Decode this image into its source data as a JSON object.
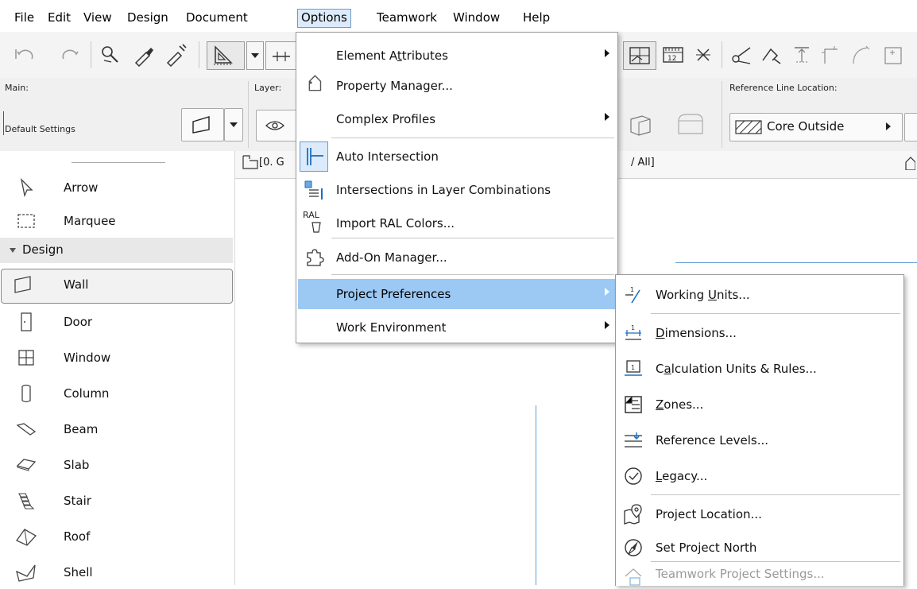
{
  "menubar": {
    "items": [
      "File",
      "Edit",
      "View",
      "Design",
      "Document",
      "Options",
      "Teamwork",
      "Window",
      "Help"
    ],
    "active": "Options"
  },
  "infobox": {
    "main_label": "Main:",
    "main_value": "Default Settings",
    "layer_label": "Layer:",
    "ref_line_label": "Reference Line Location:",
    "ref_line_value": "Core Outside"
  },
  "canvas": {
    "tab_left": "[0. G",
    "tab_right": "/ All]"
  },
  "toolbox": {
    "group": "Design",
    "tools": [
      "Arrow",
      "Marquee",
      "Wall",
      "Door",
      "Window",
      "Column",
      "Beam",
      "Slab",
      "Stair",
      "Roof",
      "Shell"
    ],
    "selected": "Wall"
  },
  "options_menu": {
    "items": [
      {
        "label": "Element Attributes",
        "submenu": true
      },
      {
        "label": "Property Manager...",
        "submenu": false
      },
      {
        "label": "Complex Profiles",
        "submenu": true
      },
      {
        "label": "Auto Intersection",
        "submenu": false
      },
      {
        "label": "Intersections in Layer Combinations",
        "submenu": false
      },
      {
        "label": "Import RAL Colors...",
        "submenu": false
      },
      {
        "label": "Add-On Manager...",
        "submenu": false
      },
      {
        "label": "Project Preferences",
        "submenu": true,
        "highlighted": true
      },
      {
        "label": "Work Environment",
        "submenu": true
      }
    ],
    "ral_icon_text": "RAL"
  },
  "prefs_submenu": {
    "items": [
      {
        "label": "Working Units..."
      },
      {
        "label": "Dimensions..."
      },
      {
        "label": "Calculation Units & Rules..."
      },
      {
        "label": "Zones..."
      },
      {
        "label": "Reference Levels..."
      },
      {
        "label": "Legacy..."
      },
      {
        "label": "Project Location..."
      },
      {
        "label": "Set Project North"
      },
      {
        "label": "Teamwork Project Settings...",
        "disabled": true
      }
    ]
  },
  "colors": {
    "highlight": "#9cc8f4",
    "accent": "#1b6fc2"
  }
}
